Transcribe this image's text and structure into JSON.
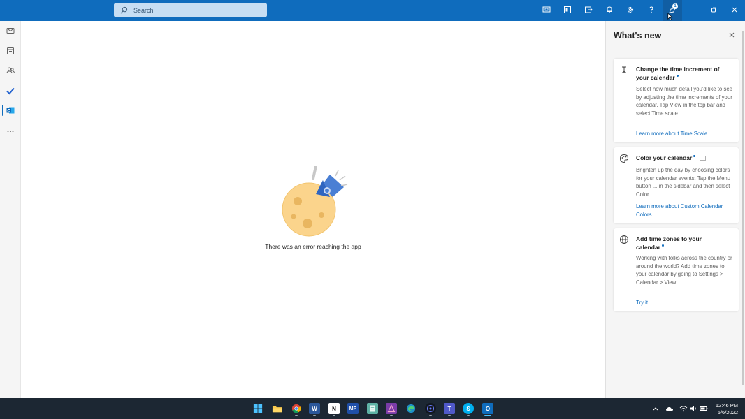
{
  "titlebar": {
    "search_placeholder": "Search",
    "accent_color": "#0f6cbd",
    "icons": [
      "meet-now-icon",
      "office-apps-icon",
      "outlook-forms-icon",
      "bell-icon",
      "gear-icon",
      "help-icon",
      "whats-new-icon",
      "minimize-icon",
      "restore-icon",
      "close-icon"
    ],
    "whats_new_badge": "1"
  },
  "rail": {
    "items": [
      "mail-icon",
      "calendar-icon",
      "people-icon",
      "todo-icon",
      "outlook-icon",
      "more-icon"
    ],
    "active": "outlook-icon"
  },
  "main": {
    "error_message": "There was an error reaching the app"
  },
  "whats_new": {
    "title": "What's new",
    "cards": [
      {
        "icon": "time-scale-icon",
        "title": "Change the time increment of your calendar",
        "description": "Select how much detail you'd like to see by adjusting the time increments of your calendar. Tap View in the top bar and select Time scale",
        "link": "Learn more about Time Scale"
      },
      {
        "icon": "palette-icon",
        "title": "Color your calendar",
        "description": "Brighten up the day by choosing colors for your calendar events. Tap the Menu button ... in the sidebar and then select Color.",
        "link": "Learn more about Custom Calendar Colors"
      },
      {
        "icon": "globe-icon",
        "title": "Add time zones to your calendar",
        "description": "Working with folks across the country or around the world? Add time zones to your calendar by going to Settings > Calendar > View.",
        "link": "Try it"
      }
    ]
  },
  "taskbar": {
    "apps": [
      "windows-start-icon",
      "file-explorer-icon",
      "chrome-icon",
      "word-icon",
      "notion-icon",
      "mp-app-icon",
      "notepad-icon",
      "affinity-icon",
      "edge-icon",
      "obs-icon",
      "teams-icon",
      "skype-icon",
      "outlook-taskbar-icon"
    ],
    "tray_icons": [
      "chevron-up-icon",
      "onedrive-icon",
      "wifi-icon",
      "speaker-icon",
      "battery-icon"
    ],
    "time": "12:46 PM",
    "date": "5/6/2022"
  }
}
